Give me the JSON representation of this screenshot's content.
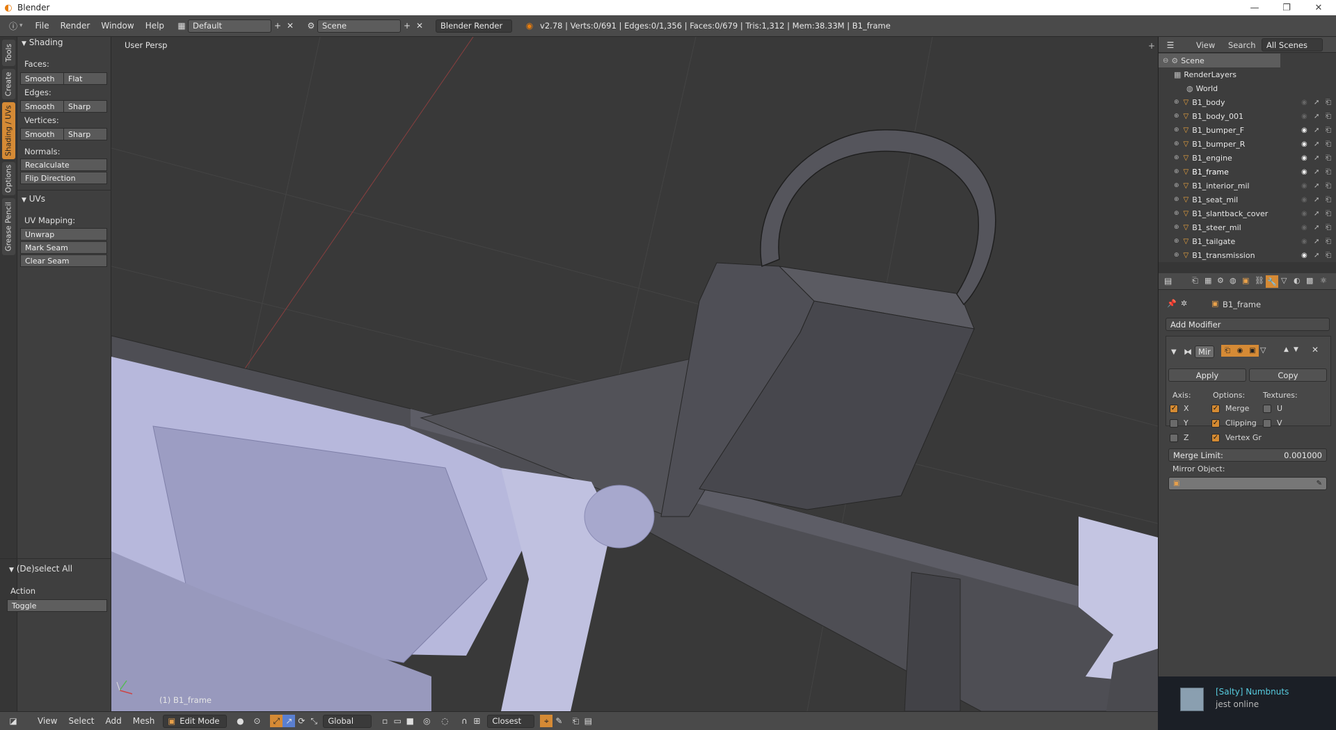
{
  "window": {
    "app_title": "Blender"
  },
  "info_header": {
    "menus": [
      "File",
      "Render",
      "Window",
      "Help"
    ],
    "layout": "Default",
    "scene": "Scene",
    "engine": "Blender Render",
    "stats": "v2.78 | Verts:0/691 | Edges:0/1,356 | Faces:0/679 | Tris:1,312 | Mem:38.33M | B1_frame"
  },
  "tool_tabs": [
    "Tools",
    "Create",
    "Shading / UVs",
    "Options",
    "Grease Pencil"
  ],
  "shading_panel": {
    "title": "Shading",
    "faces_label": "Faces:",
    "faces_smooth": "Smooth",
    "faces_flat": "Flat",
    "edges_label": "Edges:",
    "edges_smooth": "Smooth",
    "edges_sharp": "Sharp",
    "vertices_label": "Vertices:",
    "vertices_smooth": "Smooth",
    "vertices_sharp": "Sharp",
    "normals_label": "Normals:",
    "recalculate": "Recalculate",
    "flip_direction": "Flip Direction"
  },
  "uvs_panel": {
    "title": "UVs",
    "mapping_label": "UV Mapping:",
    "unwrap": "Unwrap",
    "mark_seam": "Mark Seam",
    "clear_seam": "Clear Seam"
  },
  "operator_panel": {
    "title": "(De)select All",
    "action_label": "Action",
    "action_value": "Toggle"
  },
  "viewport": {
    "view_name": "User Persp",
    "object_label": "(1) B1_frame"
  },
  "bottom_header": {
    "menus": [
      "View",
      "Select",
      "Add",
      "Mesh"
    ],
    "mode": "Edit Mode",
    "orientation": "Global",
    "snap_target": "Closest"
  },
  "outliner": {
    "tabs": [
      "View",
      "Search",
      "All Scenes"
    ],
    "scene": "Scene",
    "render_layers": "RenderLayers",
    "world": "World",
    "objects": [
      {
        "name": "B1_body",
        "visible": false
      },
      {
        "name": "B1_body_001",
        "visible": false
      },
      {
        "name": "B1_bumper_F",
        "visible": true
      },
      {
        "name": "B1_bumper_R",
        "visible": true
      },
      {
        "name": "B1_engine",
        "visible": true
      },
      {
        "name": "B1_frame",
        "visible": true
      },
      {
        "name": "B1_interior_mil",
        "visible": false
      },
      {
        "name": "B1_seat_mil",
        "visible": false
      },
      {
        "name": "B1_slantback_cover",
        "visible": false
      },
      {
        "name": "B1_steer_mil",
        "visible": false
      },
      {
        "name": "B1_tailgate",
        "visible": false
      },
      {
        "name": "B1_transmission",
        "visible": true
      }
    ]
  },
  "properties": {
    "object_name": "B1_frame",
    "add_modifier": "Add Modifier",
    "modifier_name": "Mir",
    "apply": "Apply",
    "copy": "Copy",
    "axis_label": "Axis:",
    "options_label": "Options:",
    "textures_label": "Textures:",
    "axis_x": "X",
    "axis_y": "Y",
    "axis_z": "Z",
    "axis_x_on": true,
    "axis_y_on": false,
    "axis_z_on": false,
    "merge": "Merge",
    "clipping": "Clipping",
    "vertex_groups": "Vertex Gr",
    "tex_u": "U",
    "tex_v": "V",
    "merge_limit_label": "Merge Limit:",
    "merge_limit_value": "0.001000",
    "mirror_object_label": "Mirror Object:"
  },
  "steam_notification": {
    "name": "[Salty] Numbnuts",
    "status": "jest online"
  },
  "colors": {
    "accent": "#d58a35",
    "viewport_bg": "#393939",
    "panel_bg": "#3f3f3f"
  }
}
